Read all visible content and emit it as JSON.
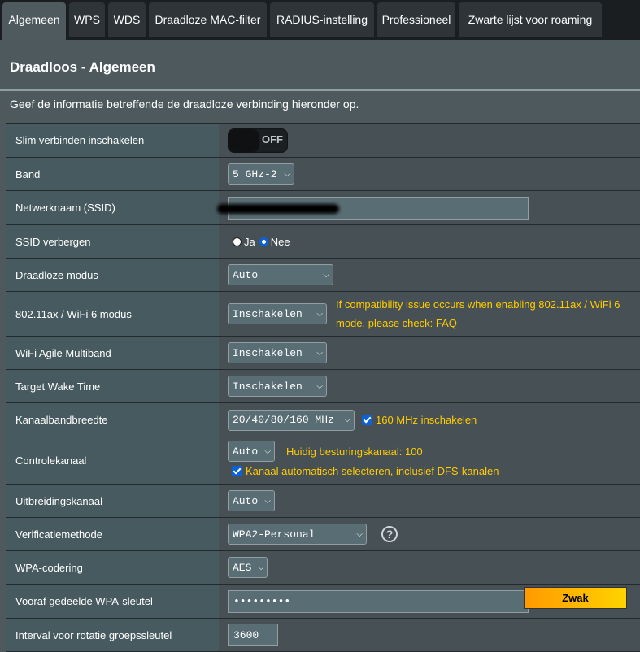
{
  "tabs": [
    "Algemeen",
    "WPS",
    "WDS",
    "Draadloze MAC-filter",
    "RADIUS-instelling",
    "Professioneel",
    "Zwarte lijst voor roaming"
  ],
  "title": "Draadloos - Algemeen",
  "description": "Geef de informatie betreffende de draadloze verbinding hieronder op.",
  "rows": {
    "smart_connect": {
      "label": "Slim verbinden inschakelen",
      "toggle": "OFF"
    },
    "band": {
      "label": "Band",
      "value": "5 GHz-2"
    },
    "ssid": {
      "label": "Netwerknaam (SSID)",
      "value": ""
    },
    "hide_ssid": {
      "label": "SSID verbergen",
      "yes": "Ja",
      "no": "Nee",
      "selected": "Nee"
    },
    "mode": {
      "label": "Draadloze modus",
      "value": "Auto"
    },
    "ax": {
      "label": "802.11ax / WiFi 6 modus",
      "value": "Inschakelen",
      "note": "If compatibility issue occurs when enabling 802.11ax / WiFi 6 mode, please check:",
      "link": "FAQ"
    },
    "agile": {
      "label": "WiFi Agile Multiband",
      "value": "Inschakelen"
    },
    "twt": {
      "label": "Target Wake Time",
      "value": "Inschakelen"
    },
    "bw": {
      "label": "Kanaalbandbreedte",
      "value": "20/40/80/160 MHz",
      "check": "160 MHz inschakelen"
    },
    "control": {
      "label": "Controlekanaal",
      "value": "Auto",
      "current": "Huidig besturingskanaal: 100",
      "check": "Kanaal automatisch selecteren, inclusief DFS-kanalen"
    },
    "ext": {
      "label": "Uitbreidingskanaal",
      "value": "Auto"
    },
    "auth": {
      "label": "Verificatiemethode",
      "value": "WPA2-Personal",
      "help": "?"
    },
    "enc": {
      "label": "WPA-codering",
      "value": "AES"
    },
    "psk": {
      "label": "Vooraf gedeelde WPA-sleutel",
      "value": "•••••••••",
      "strength": "Zwak"
    },
    "rekey": {
      "label": "Interval voor rotatie groepssleutel",
      "value": "3600"
    }
  },
  "colors": {
    "accent": "#0b62d6",
    "note": "#ffcc00"
  }
}
